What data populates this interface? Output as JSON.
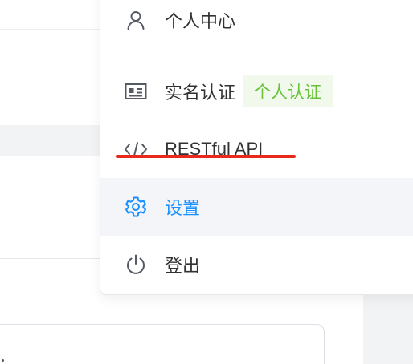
{
  "menu": {
    "items": [
      {
        "label": "个人中心",
        "icon": "user-icon"
      },
      {
        "label": "实名认证",
        "icon": "id-card-icon",
        "badge": "个人认证"
      },
      {
        "label": "RESTful API",
        "icon": "code-icon"
      },
      {
        "label": "设置",
        "icon": "gear-icon",
        "active": true
      },
      {
        "label": "登出",
        "icon": "power-icon"
      }
    ]
  },
  "colors": {
    "accent": "#1890ff",
    "badge_text": "#67c23a",
    "badge_bg": "#f0f9eb",
    "annotation_underline": "#e8291c"
  }
}
